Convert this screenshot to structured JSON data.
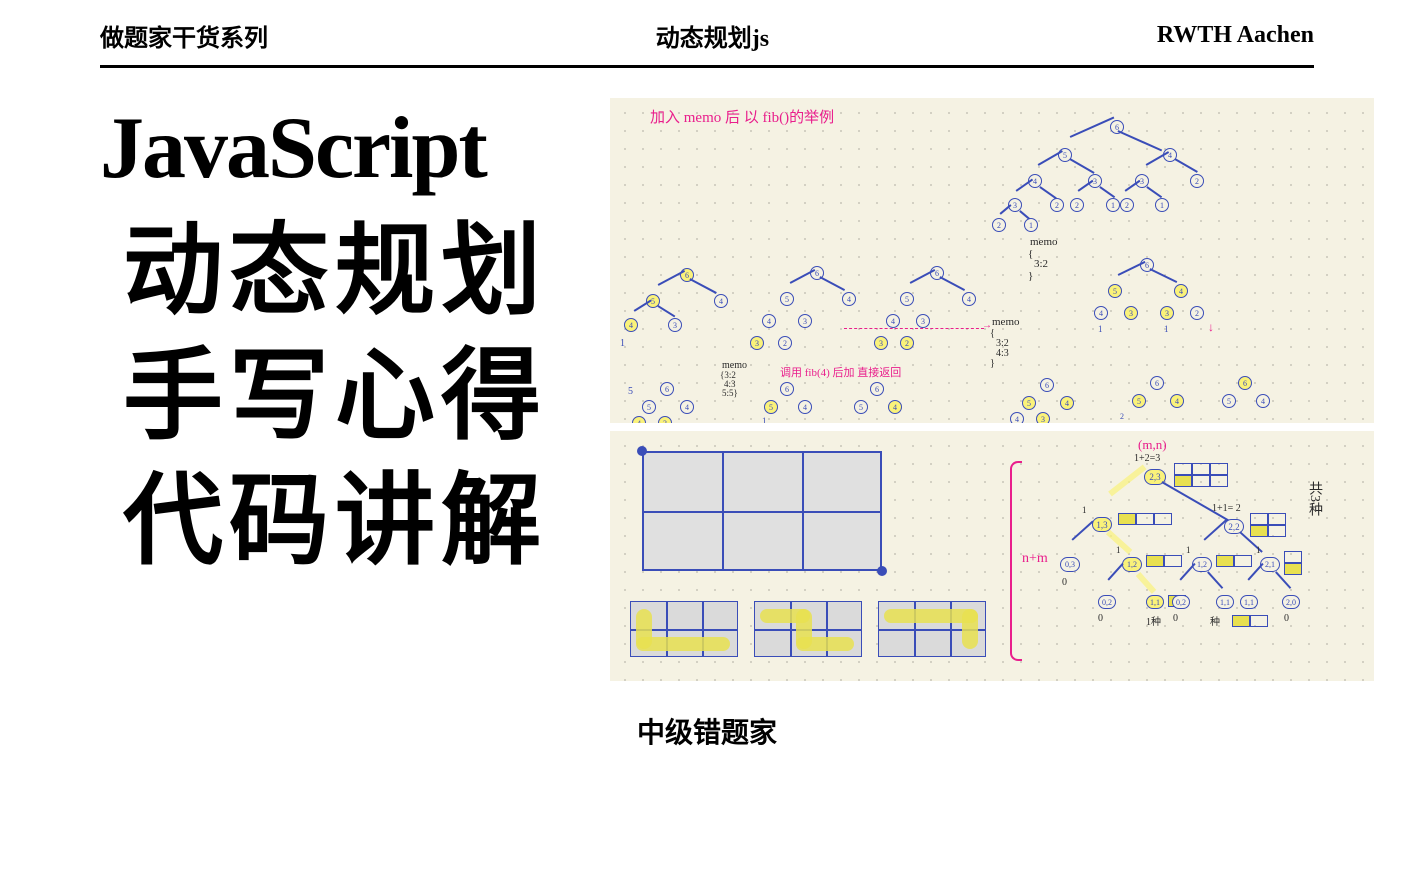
{
  "header": {
    "left": "做题家干货系列",
    "center": "动态规划js",
    "right": "RWTH Aachen"
  },
  "title": {
    "line1": "JavaScript",
    "line2": "动态规划",
    "line3": "手写心得",
    "line4": "代码讲解"
  },
  "footer": "中级错题家",
  "panel_top": {
    "caption": "加入 memo 后 以 fib()的举例",
    "memo_label1": "memo",
    "memo_content1_l1": "{",
    "memo_content1_l2": "3:2",
    "memo_content1_l3": "}",
    "memo_label2": "memo",
    "memo_content2_l1": "{",
    "memo_content2_l2": "3:2",
    "memo_content2_l3": "4:3",
    "memo_content2_l4": "}",
    "memo_label3": "memo",
    "memo_content3_l1": "{3:2",
    "memo_content3_l2": "4:3",
    "memo_content3_l3": "5:5}",
    "note_pink": "调用 fib(4) 后加 直接返回",
    "node_values": [
      "6",
      "5",
      "4",
      "3",
      "2",
      "1"
    ],
    "leaf_values": [
      "1",
      "1",
      "2",
      "3",
      "5"
    ]
  },
  "panel_bottom": {
    "label_mn": "(m,n)",
    "label_ntm": "n+m",
    "label_1plus2": "1+2=3",
    "label_1plus1": "1+1= 2",
    "label_0": "0",
    "label_1": "1",
    "label_1zhong": "1种",
    "label_right": "共3种",
    "tree_nodes": {
      "root": "2,3",
      "l": "1,3",
      "r": "2,2",
      "ll": "0,3",
      "lr": "1,2",
      "rl": "1,2",
      "rr": "2,1",
      "lrl": "0,2",
      "lrr": "1,1",
      "rll": "0,2",
      "rlr": "1,1",
      "rrl": "1,1",
      "rrr": "2,0"
    }
  }
}
